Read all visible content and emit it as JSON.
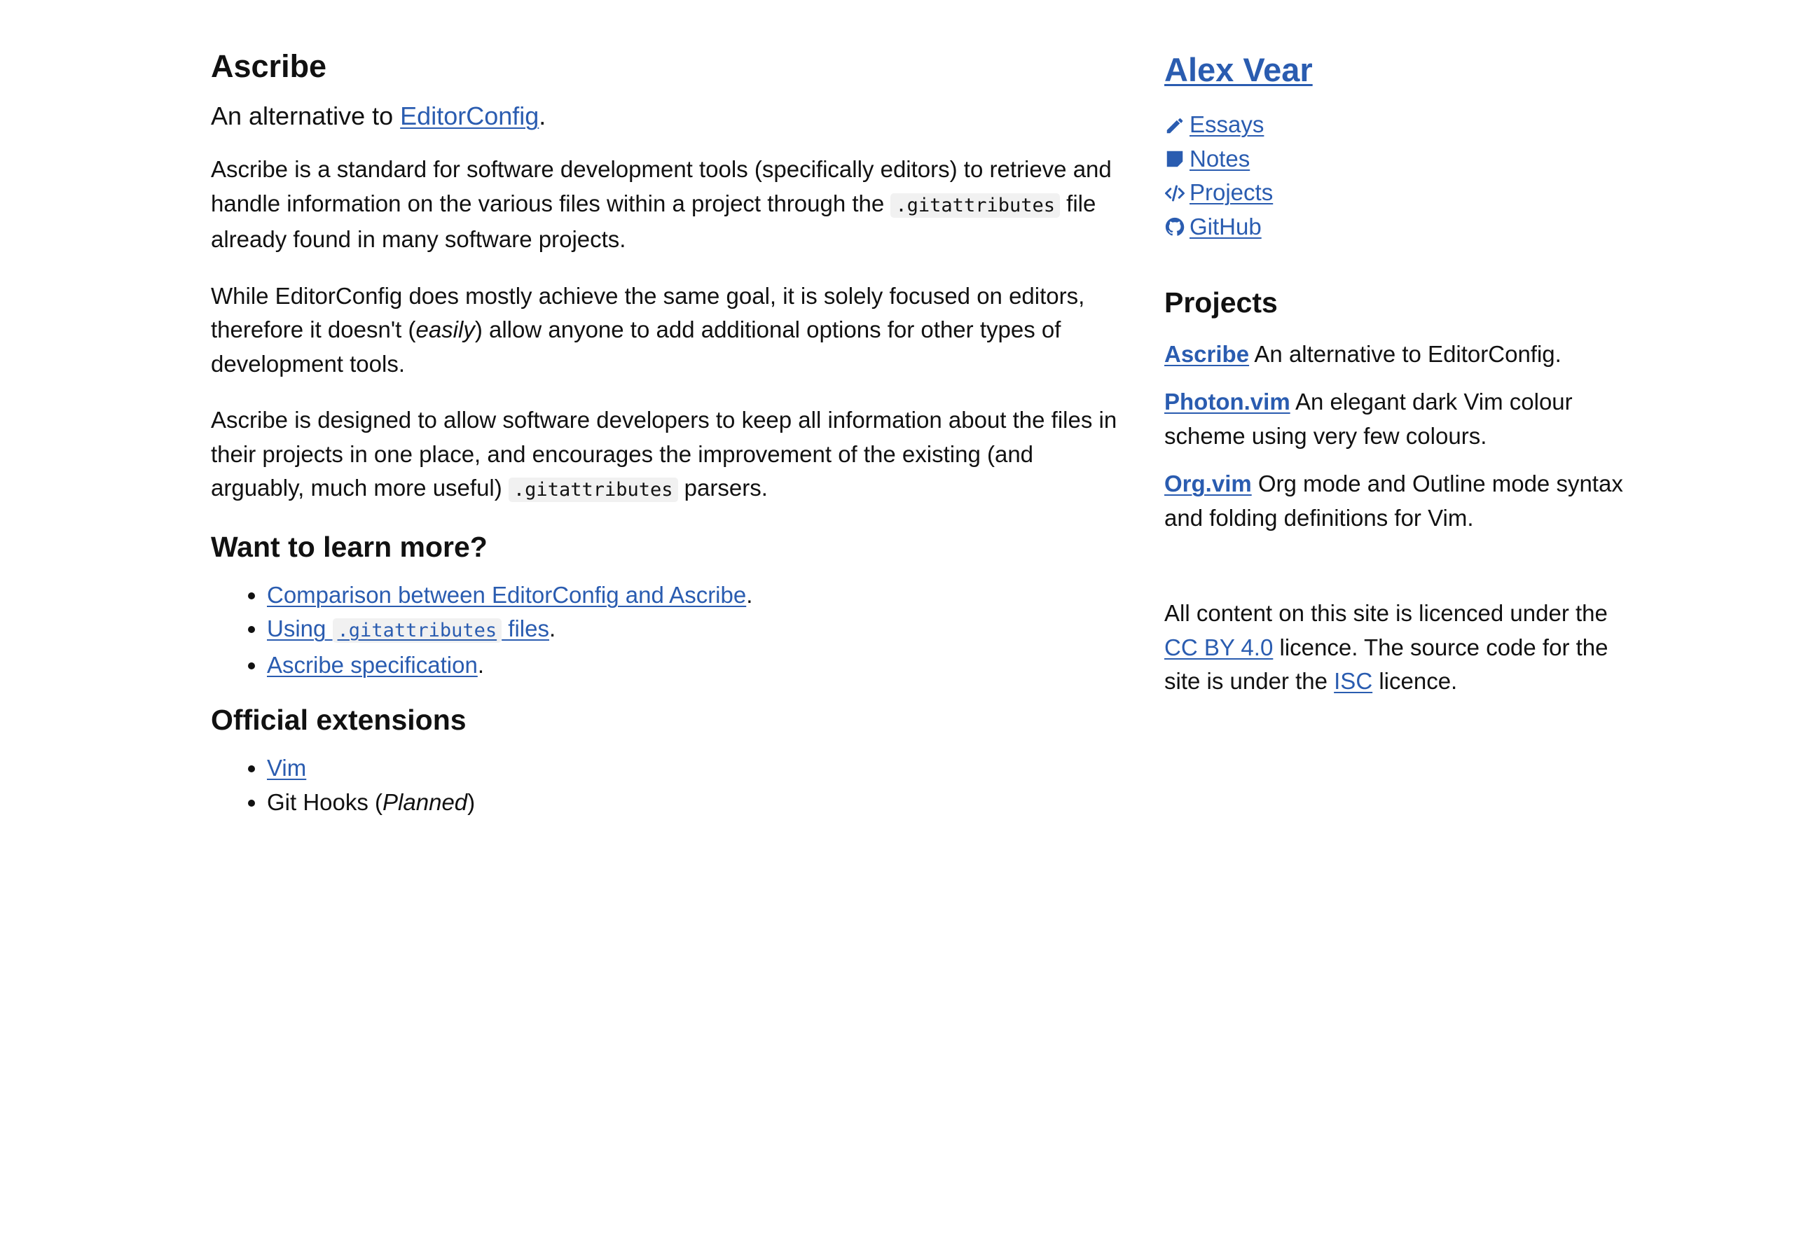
{
  "main": {
    "title": "Ascribe",
    "lead": {
      "prefix": "An alternative to ",
      "link": "EditorConfig",
      "suffix": "."
    },
    "para1": {
      "text1": "Ascribe is a standard for software development tools (specifically editors) to retrieve and handle information on the various files within a project through the ",
      "code": ".gitattributes",
      "text2": " file already found in many software projects."
    },
    "para2": {
      "text1": "While EditorConfig does mostly achieve the same goal, it is solely focused on editors, therefore it doesn't (",
      "em": "easily",
      "text2": ") allow anyone to add additional options for other types of development tools."
    },
    "para3": {
      "text1": "Ascribe is designed to allow software developers to keep all information about the files in their projects in one place, and encourages the improvement of the existing (and arguably, much more useful) ",
      "code": ".gitattributes",
      "text2": " parsers."
    },
    "learn_more": {
      "heading": "Want to learn more?",
      "items": [
        {
          "link": "Comparison between EditorConfig and Ascribe",
          "suffix": "."
        },
        {
          "link_prefix": "Using ",
          "code": ".gitattributes",
          "link_suffix": " files",
          "suffix": "."
        },
        {
          "link": "Ascribe specification",
          "suffix": "."
        }
      ]
    },
    "extensions": {
      "heading": "Official extensions",
      "items": [
        {
          "link": "Vim"
        },
        {
          "text1": "Git Hooks (",
          "em": "Planned",
          "text2": ")"
        }
      ]
    }
  },
  "sidebar": {
    "site_title": "Alex Vear",
    "nav": [
      {
        "label": "Essays",
        "icon": "pencil-icon"
      },
      {
        "label": "Notes",
        "icon": "note-icon"
      },
      {
        "label": "Projects",
        "icon": "code-icon"
      },
      {
        "label": "GitHub",
        "icon": "github-icon"
      }
    ],
    "projects_heading": "Projects",
    "projects": [
      {
        "name": "Ascribe",
        "description": " An alternative to EditorConfig."
      },
      {
        "name": "Photon.vim",
        "description": " An elegant dark Vim colour scheme using very few colours."
      },
      {
        "name": "Org.vim",
        "description": " Org mode and Outline mode syntax and folding definitions for Vim."
      }
    ],
    "licence": {
      "text1": "All content on this site is licenced under the ",
      "link1": "CC BY 4.0",
      "text2": " licence. The source code for the site is under the ",
      "link2": "ISC",
      "text3": " licence."
    }
  },
  "colors": {
    "link": "#2a5cb0",
    "text": "#111111",
    "code_bg": "#f1f1f1"
  }
}
